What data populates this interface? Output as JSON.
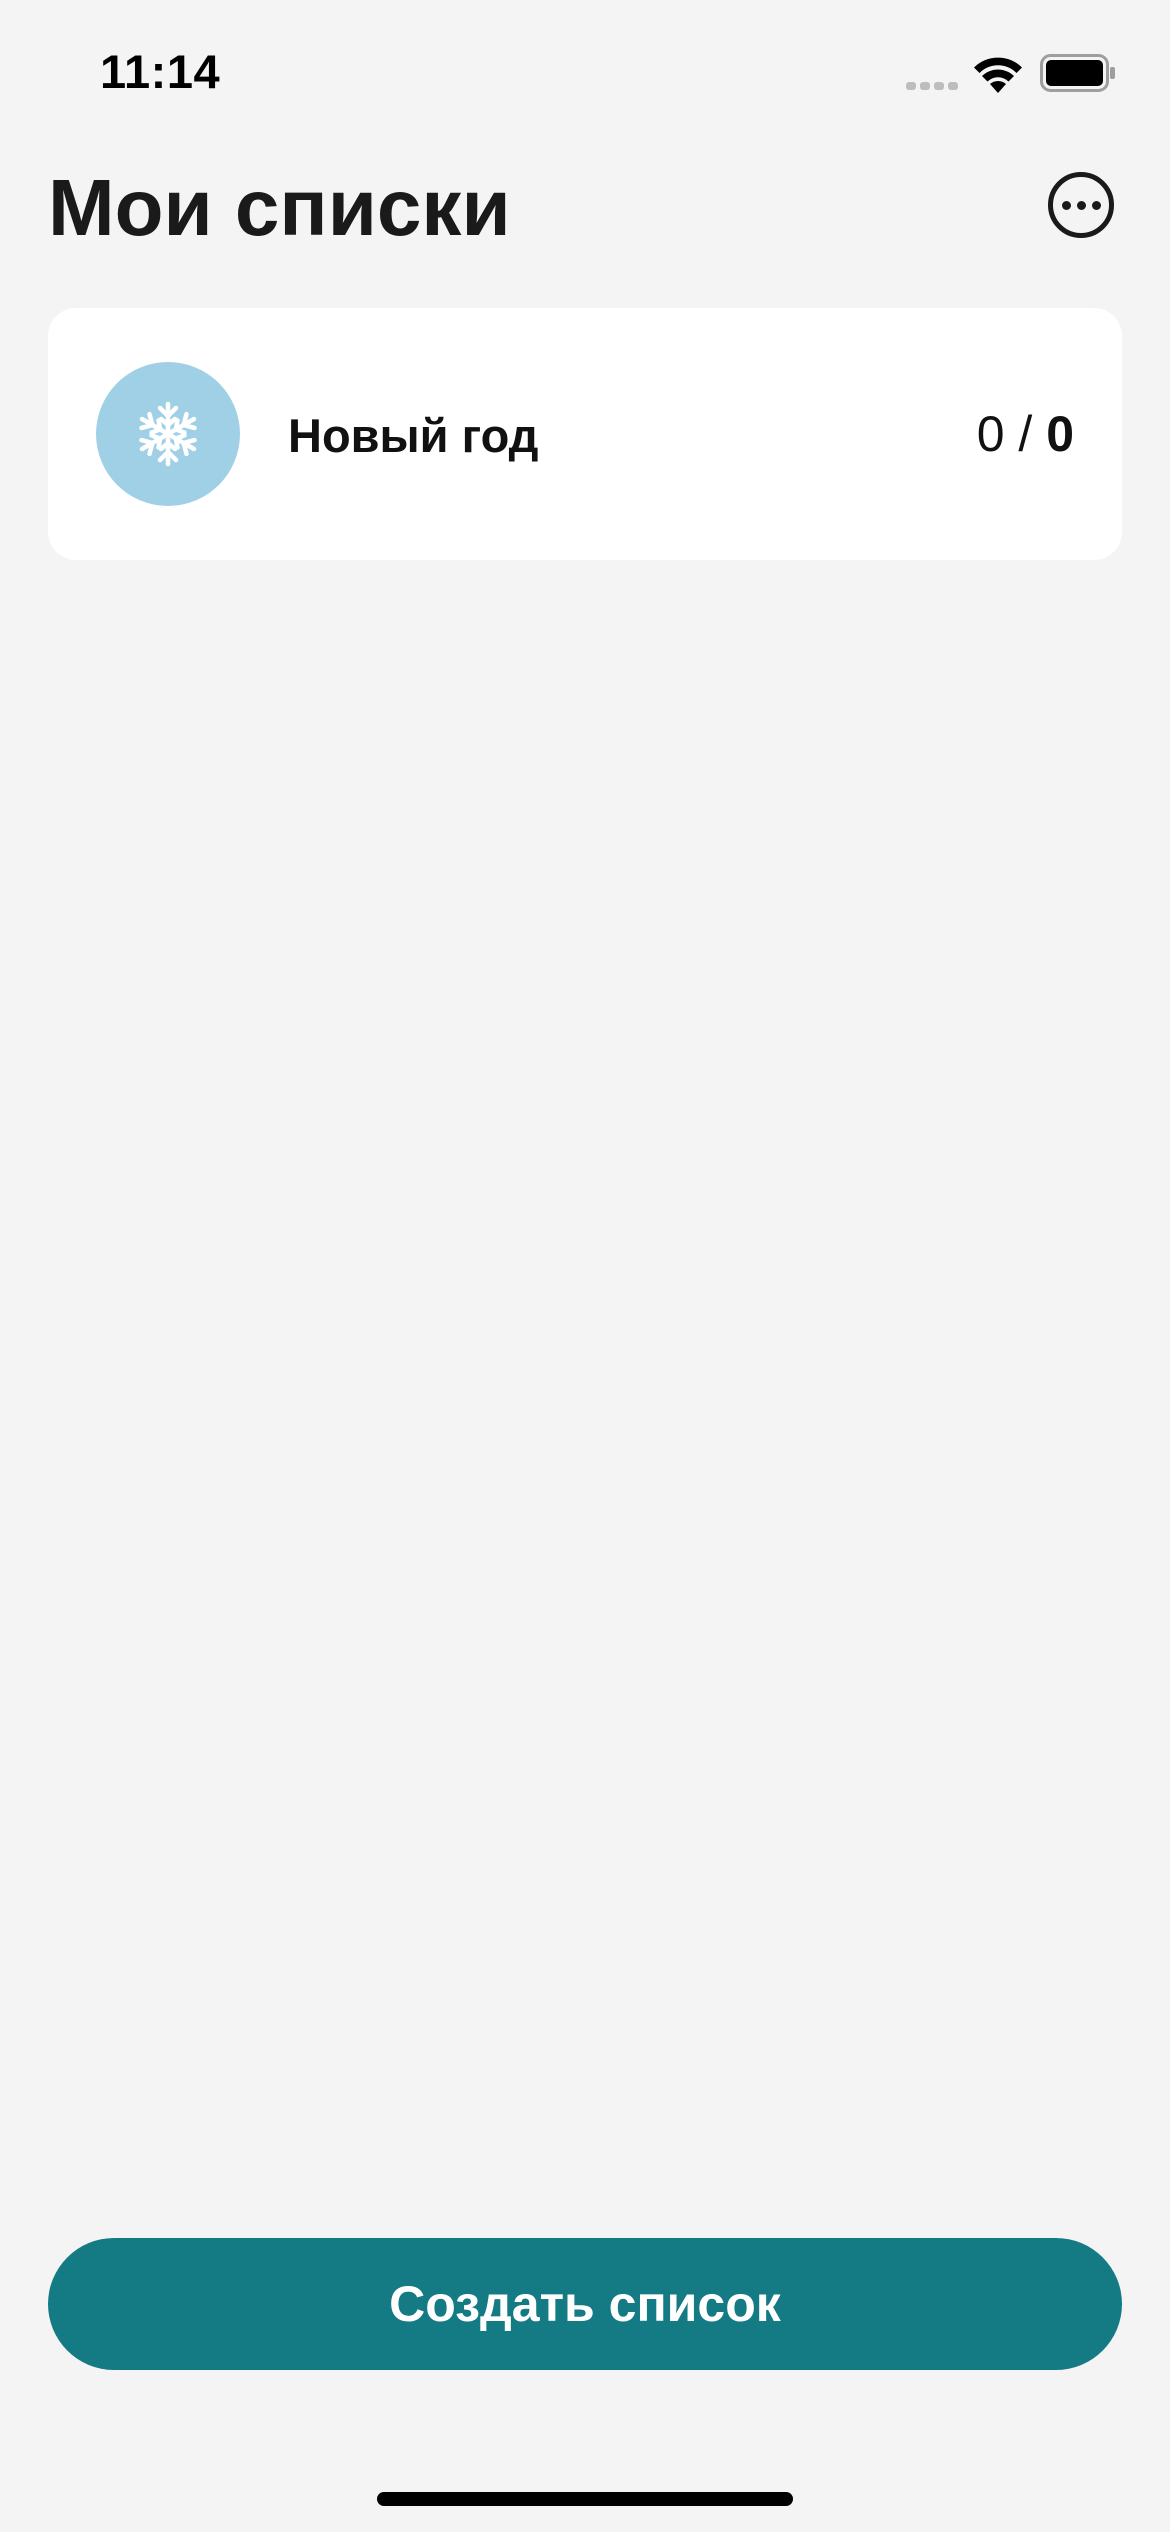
{
  "status_bar": {
    "time": "11:14",
    "icons": [
      "signal-icon",
      "wifi-icon",
      "battery-icon"
    ]
  },
  "header": {
    "title": "Мои списки",
    "more_icon": "ellipsis-circle-icon"
  },
  "lists": [
    {
      "name": "Новый год",
      "icon": "snowflake-icon",
      "icon_bg": "#9fd0e6",
      "done": "0",
      "separator": " / ",
      "total": "0"
    }
  ],
  "footer": {
    "create_label": "Создать список",
    "create_color": "#147a83"
  },
  "colors": {
    "background": "#f4f4f4",
    "card": "#ffffff",
    "accent": "#147a83"
  }
}
